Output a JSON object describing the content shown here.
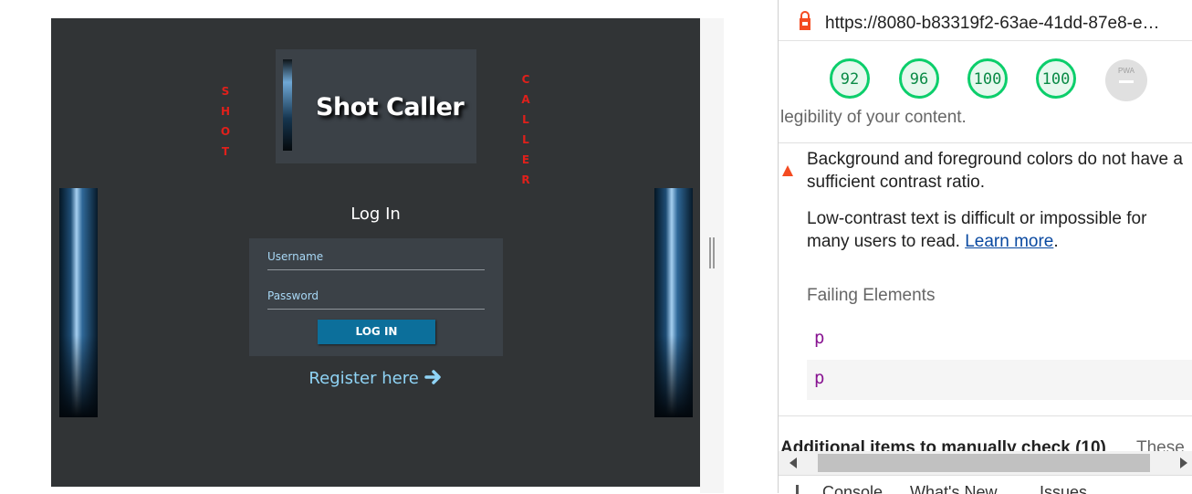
{
  "app": {
    "vertical_left": "SHOT",
    "vertical_right": "CALLER",
    "title": "Shot Caller",
    "login_heading": "Log In",
    "username_label": "Username",
    "password_label": "Password",
    "login_button": "LOG IN",
    "register_link": "Register here"
  },
  "devtools": {
    "url": "https://8080-b83319f2-63ae-41dd-87e8-e…",
    "scores": [
      "92",
      "96",
      "100",
      "100"
    ],
    "pwa_label": "PWA",
    "clipped_text": "legibility of your content.",
    "audit_title": "Background and foreground colors do not have a sufficient contrast ratio.",
    "audit_description": "Low-contrast text is difficult or impossible for many users to read.",
    "learn_more": "Learn more",
    "learn_more_suffix": ".",
    "failing_heading": "Failing Elements",
    "failing_elements": [
      "p",
      "p"
    ],
    "additional_title": "Additional items to manually check (10)",
    "additional_rest": "These",
    "drawer_tabs": [
      "Console",
      "What's New",
      "Issues"
    ]
  },
  "colors": {
    "app_bg": "#313436",
    "card_bg": "#3b4147",
    "accent_button": "#0c6f9b",
    "score_green": "#0cce6b",
    "vertical_red": "#e0201b"
  }
}
